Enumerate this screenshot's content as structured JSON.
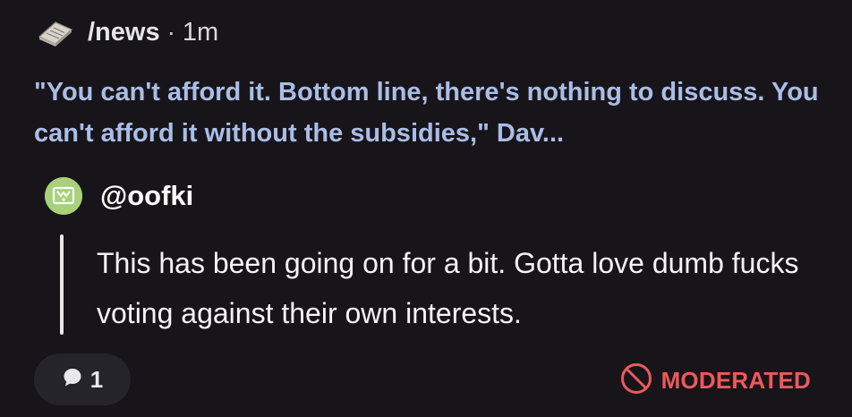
{
  "post": {
    "community": "/news",
    "separator": "·",
    "time": "1m",
    "community_icon": "newspaper-icon",
    "title": "\"You can't afford it. Bottom line, there's nothing to discuss. You can't afford it without the subsidies,\" Dav..."
  },
  "comment": {
    "author": "@oofki",
    "avatar_color": "#a8d17a",
    "body": "This has been going on for a bit. Gotta love dumb fucks voting against their own interests."
  },
  "footer": {
    "reply_icon": "speech-bubble-icon",
    "reply_count": "1",
    "moderated_icon": "prohibited-icon",
    "moderated_label": "MODERATED",
    "moderated_color": "#ec5a5a"
  },
  "colors": {
    "background": "#17151a",
    "title": "#aabde6"
  }
}
